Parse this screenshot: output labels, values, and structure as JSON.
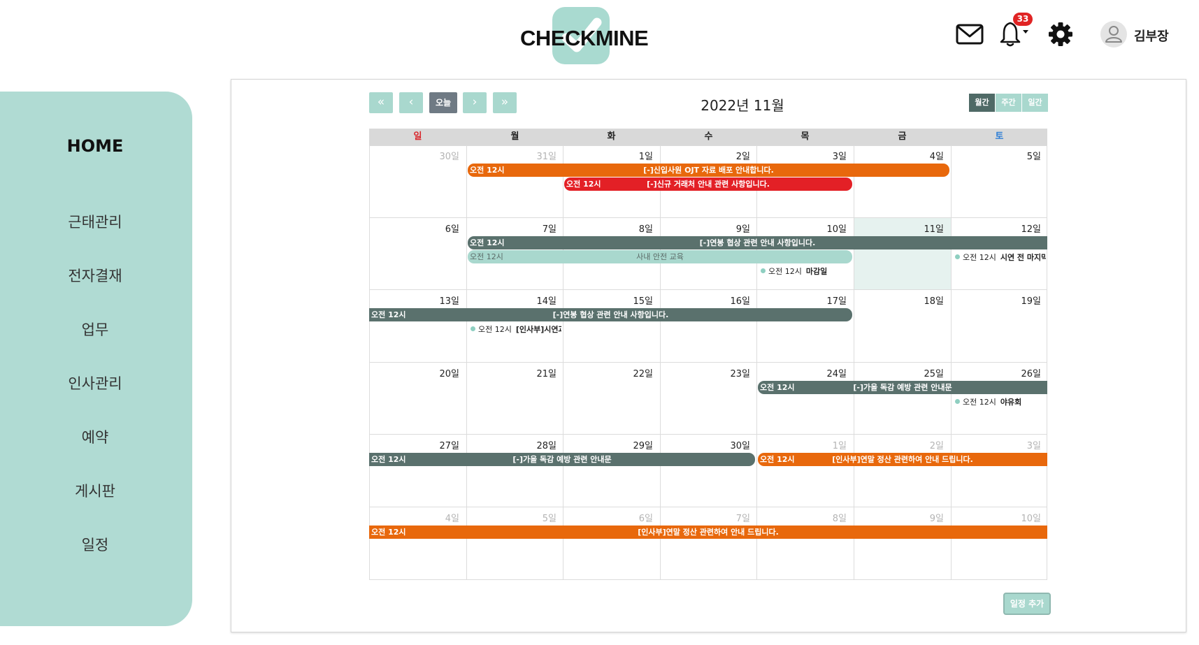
{
  "header": {
    "logo_text": "CHECKMINE",
    "notification_count": "33",
    "user_name": "김부장"
  },
  "sidebar": {
    "home_label": "HOME",
    "items": [
      {
        "label": "근태관리"
      },
      {
        "label": "전자결재"
      },
      {
        "label": "업무"
      },
      {
        "label": "인사관리"
      },
      {
        "label": "예약"
      },
      {
        "label": "게시판"
      },
      {
        "label": "일정"
      }
    ]
  },
  "calendar": {
    "title": "2022년 11월",
    "nav": {
      "first": "«",
      "prev": "‹",
      "today": "오늘",
      "next": "›",
      "last": "»"
    },
    "views": [
      {
        "label": "월간",
        "active": true
      },
      {
        "label": "주간",
        "active": false
      },
      {
        "label": "일간",
        "active": false
      }
    ],
    "weekdays": [
      {
        "label": "일",
        "color": "#d9262b"
      },
      {
        "label": "월",
        "color": "#222222"
      },
      {
        "label": "화",
        "color": "#222222"
      },
      {
        "label": "수",
        "color": "#222222"
      },
      {
        "label": "목",
        "color": "#222222"
      },
      {
        "label": "금",
        "color": "#222222"
      },
      {
        "label": "토",
        "color": "#2f7fd6"
      }
    ],
    "weeks": [
      [
        {
          "label": "30일",
          "other": true
        },
        {
          "label": "31일",
          "other": true
        },
        {
          "label": "1일"
        },
        {
          "label": "2일"
        },
        {
          "label": "3일"
        },
        {
          "label": "4일"
        },
        {
          "label": "5일"
        }
      ],
      [
        {
          "label": "6일"
        },
        {
          "label": "7일"
        },
        {
          "label": "8일"
        },
        {
          "label": "9일"
        },
        {
          "label": "10일"
        },
        {
          "label": "11일",
          "today": true
        },
        {
          "label": "12일"
        }
      ],
      [
        {
          "label": "13일"
        },
        {
          "label": "14일"
        },
        {
          "label": "15일"
        },
        {
          "label": "16일"
        },
        {
          "label": "17일"
        },
        {
          "label": "18일"
        },
        {
          "label": "19일"
        }
      ],
      [
        {
          "label": "20일"
        },
        {
          "label": "21일"
        },
        {
          "label": "22일"
        },
        {
          "label": "23일"
        },
        {
          "label": "24일"
        },
        {
          "label": "25일"
        },
        {
          "label": "26일"
        }
      ],
      [
        {
          "label": "27일"
        },
        {
          "label": "28일"
        },
        {
          "label": "29일"
        },
        {
          "label": "30일"
        },
        {
          "label": "1일",
          "other": true
        },
        {
          "label": "2일",
          "other": true
        },
        {
          "label": "3일",
          "other": true
        }
      ],
      [
        {
          "label": "4일",
          "other": true
        },
        {
          "label": "5일",
          "other": true
        },
        {
          "label": "6일",
          "other": true
        },
        {
          "label": "7일",
          "other": true
        },
        {
          "label": "8일",
          "other": true
        },
        {
          "label": "9일",
          "other": true
        },
        {
          "label": "10일",
          "other": true
        }
      ]
    ],
    "bar_events": [
      {
        "week": 0,
        "slot": 0,
        "start": 1,
        "end": 5,
        "time": "오전 12시",
        "title": "[-]신입사원 OJT 자료 배포 안내합니다.",
        "color": "orange",
        "cont_left": false,
        "cont_right": false
      },
      {
        "week": 0,
        "slot": 1,
        "start": 2,
        "end": 4,
        "time": "오전 12시",
        "title": "[-]신규 거래처 안내 관련 사항입니다.",
        "color": "red",
        "cont_left": false,
        "cont_right": false
      },
      {
        "week": 1,
        "slot": 0,
        "start": 1,
        "end": 6,
        "time": "오전 12시",
        "title": "[-]연봉 협상 관련 안내 사항입니다.",
        "color": "slate",
        "cont_left": false,
        "cont_right": true
      },
      {
        "week": 1,
        "slot": 1,
        "start": 1,
        "end": 4,
        "time": "오전 12시",
        "title": "사내 안전 교육",
        "color": "mint",
        "cont_left": false,
        "cont_right": false
      },
      {
        "week": 2,
        "slot": 0,
        "start": 0,
        "end": 4,
        "time": "오전 12시",
        "title": "[-]연봉 협상 관련 안내 사항입니다.",
        "color": "slate",
        "cont_left": true,
        "cont_right": false
      },
      {
        "week": 3,
        "slot": 0,
        "start": 4,
        "end": 6,
        "time": "오전 12시",
        "title": "[-]가을 독감 예방 관련 안내문",
        "color": "slate",
        "cont_left": false,
        "cont_right": true
      },
      {
        "week": 4,
        "slot": 0,
        "start": 0,
        "end": 3,
        "time": "오전 12시",
        "title": "[-]가을 독감 예방 관련 안내문",
        "color": "slate",
        "cont_left": true,
        "cont_right": false
      },
      {
        "week": 4,
        "slot": 0,
        "start": 4,
        "end": 6,
        "time": "오전 12시",
        "title": "[인사부]연말 정산 관련하여 안내 드립니다.",
        "color": "orange",
        "cont_left": false,
        "cont_right": true
      },
      {
        "week": 5,
        "slot": 0,
        "start": 0,
        "end": 6,
        "time": "오전 12시",
        "title": "[인사부]연말 정산 관련하여 안내 드립니다.",
        "color": "orange",
        "cont_left": true,
        "cont_right": true
      }
    ],
    "dot_events": [
      {
        "week": 1,
        "slot": 1,
        "day": 6,
        "time": "오전 12시",
        "title": "시연 전 마지막 테"
      },
      {
        "week": 1,
        "slot": 2,
        "day": 4,
        "time": "오전 12시",
        "title": "마감일"
      },
      {
        "week": 2,
        "slot": 1,
        "day": 1,
        "time": "오전 12시",
        "title": "[인사부]시연과 관"
      },
      {
        "week": 3,
        "slot": 1,
        "day": 6,
        "time": "오전 12시",
        "title": "야유회"
      }
    ],
    "add_label": "일정 추가"
  },
  "colors": {
    "accent_mint": "#a9d8ce",
    "sidebar_bg": "#b0dbd3",
    "event_orange": "#e8680c",
    "event_red": "#e32026",
    "event_slate": "#5a716d",
    "badge_red": "#e02424"
  }
}
